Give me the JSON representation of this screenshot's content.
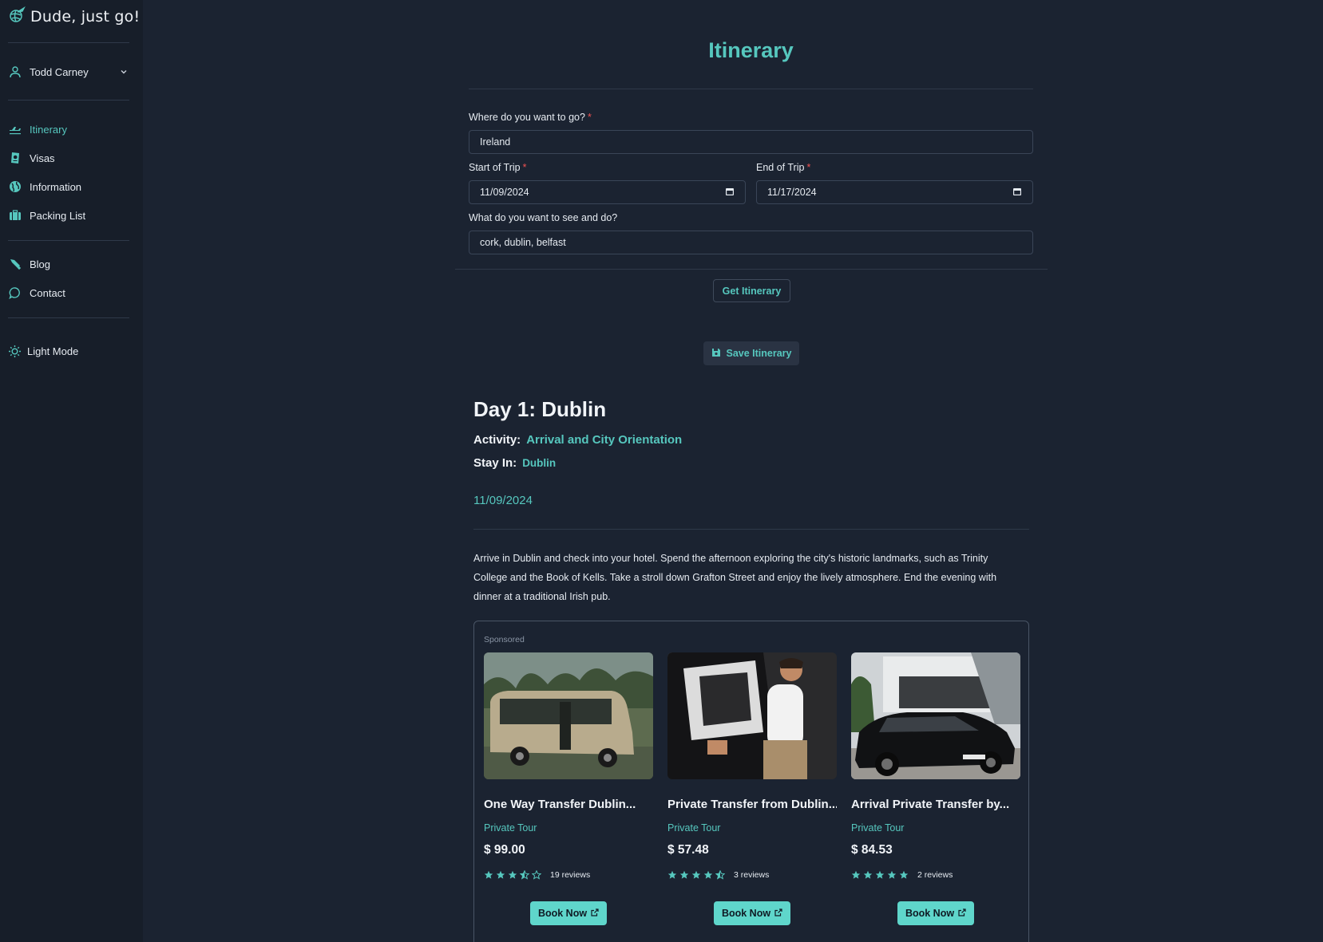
{
  "app": {
    "title": "Dude, just go!"
  },
  "sidebar": {
    "user": "Todd Carney",
    "nav": [
      {
        "label": "Itinerary",
        "icon": "plane-icon",
        "active": true
      },
      {
        "label": "Visas",
        "icon": "passport-icon"
      },
      {
        "label": "Information",
        "icon": "globe-icon"
      },
      {
        "label": "Packing List",
        "icon": "suitcase-icon"
      }
    ],
    "nav2": [
      {
        "label": "Blog",
        "icon": "pen-icon"
      },
      {
        "label": "Contact",
        "icon": "chat-icon"
      }
    ],
    "theme_toggle": "Light Mode"
  },
  "main": {
    "title": "Itinerary",
    "form": {
      "destination_label": "Where do you want to go?",
      "destination_value": "Ireland",
      "start_label": "Start of Trip",
      "start_value": "11/09/2024",
      "end_label": "End of Trip",
      "end_value": "11/17/2024",
      "interests_label": "What do you want to see and do?",
      "interests_value": "cork, dublin, belfast",
      "required_mark": "*"
    },
    "get_button": "Get Itinerary",
    "save_button": "Save Itinerary",
    "day": {
      "title": "Day 1: Dublin",
      "activity_label": "Activity:",
      "activity_value": "Arrival and City Orientation",
      "stay_label": "Stay In:",
      "stay_value": "Dublin",
      "date": "11/09/2024",
      "description": "Arrive in Dublin and check into your hotel. Spend the afternoon exploring the city's historic landmarks, such as Trinity College and the Book of Kells. Take a stroll down Grafton Street and enjoy the lively atmosphere. End the evening with dinner at a traditional Irish pub."
    },
    "sponsored": {
      "label": "Sponsored",
      "cards": [
        {
          "title": "One Way Transfer Dublin...",
          "category": "Private Tour",
          "price": "$ 99.00",
          "rating": 3.5,
          "reviews": "19 reviews",
          "book": "Book Now",
          "image": "minibus-photo"
        },
        {
          "title": "Private Transfer from Dublin...",
          "category": "Private Tour",
          "price": "$ 57.48",
          "rating": 4.5,
          "reviews": "3 reviews",
          "book": "Book Now",
          "image": "chauffeur-door-photo"
        },
        {
          "title": "Arrival Private Transfer by...",
          "category": "Private Tour",
          "price": "$ 84.53",
          "rating": 5,
          "reviews": "2 reviews",
          "book": "Book Now",
          "image": "black-sedan-photo"
        }
      ]
    }
  }
}
